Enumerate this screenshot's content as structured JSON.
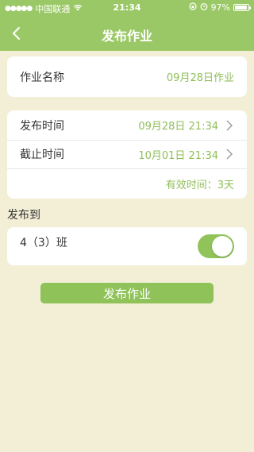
{
  "status_bar": {
    "carrier": "中国联通",
    "time": "21:34",
    "battery_percent": "97%"
  },
  "nav": {
    "title": "发布作业"
  },
  "homework_name": {
    "label": "作业名称",
    "value": "09月28日作业"
  },
  "schedule": {
    "publish_label": "发布时间",
    "publish_value": "09月28日 21:34",
    "deadline_label": "截止时间",
    "deadline_value": "10月01日 21:34",
    "valid_label": "有效时间：",
    "valid_value": "3天"
  },
  "publish_to": {
    "section_title": "发布到",
    "class_label": "4（3）班",
    "toggle_on": true
  },
  "actions": {
    "submit_label": "发布作业"
  },
  "colors": {
    "header": "#9bc866",
    "accent": "#8fbe57",
    "background": "#f2efd6"
  }
}
